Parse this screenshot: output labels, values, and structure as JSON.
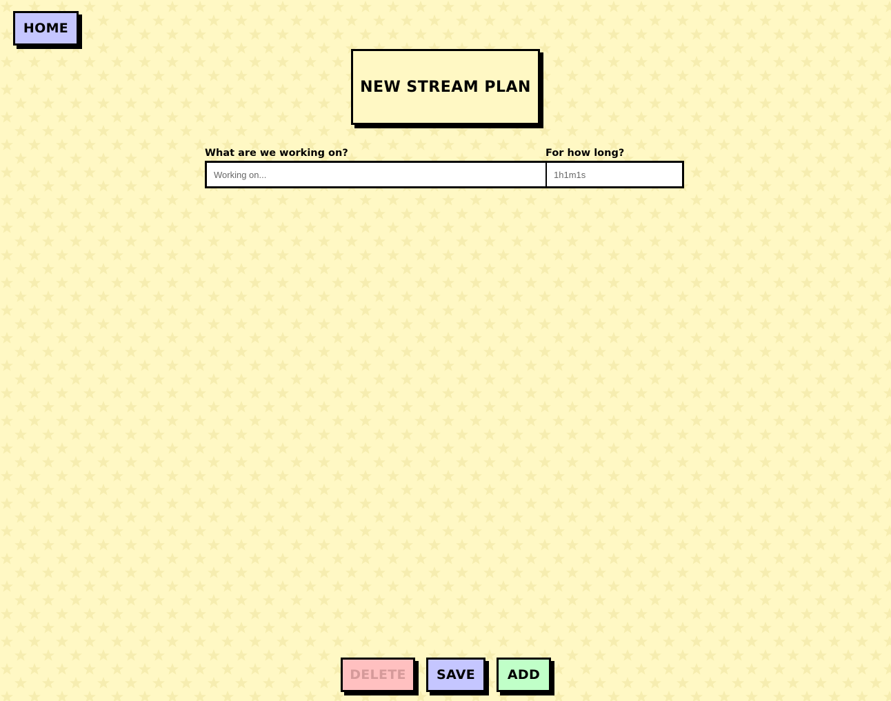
{
  "nav": {
    "home_label": "HOME"
  },
  "page": {
    "title": "NEW STREAM PLAN"
  },
  "form": {
    "task_label": "What are we working on?",
    "task_placeholder": "Working on...",
    "task_value": "",
    "duration_label": "For how long?",
    "duration_placeholder": "1h1m1s",
    "duration_value": ""
  },
  "actions": {
    "delete_label": "DELETE",
    "save_label": "SAVE",
    "add_label": "ADD"
  },
  "colors": {
    "background": "#fff8c4",
    "star": "#f6edb0",
    "home_button": "#c5c6ff",
    "save_button": "#c5c6ff",
    "delete_button": "#ffc0c0",
    "add_button": "#c0ffc8"
  }
}
